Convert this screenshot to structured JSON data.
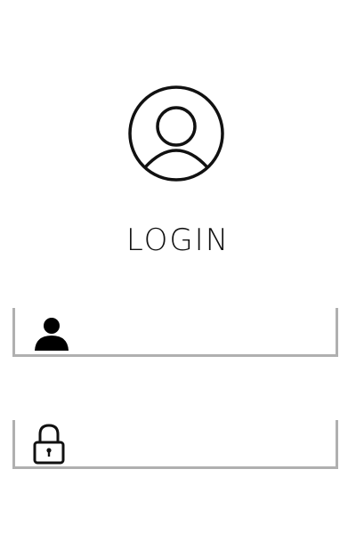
{
  "title": "LOGIN",
  "avatar": {
    "icon": "user-circle-icon"
  },
  "fields": {
    "username": {
      "icon": "user-icon",
      "value": "",
      "placeholder": ""
    },
    "password": {
      "icon": "lock-icon",
      "value": "",
      "placeholder": ""
    }
  },
  "colors": {
    "background": "#ffffff",
    "text": "#111111",
    "field_border": "#b0b0b0"
  }
}
